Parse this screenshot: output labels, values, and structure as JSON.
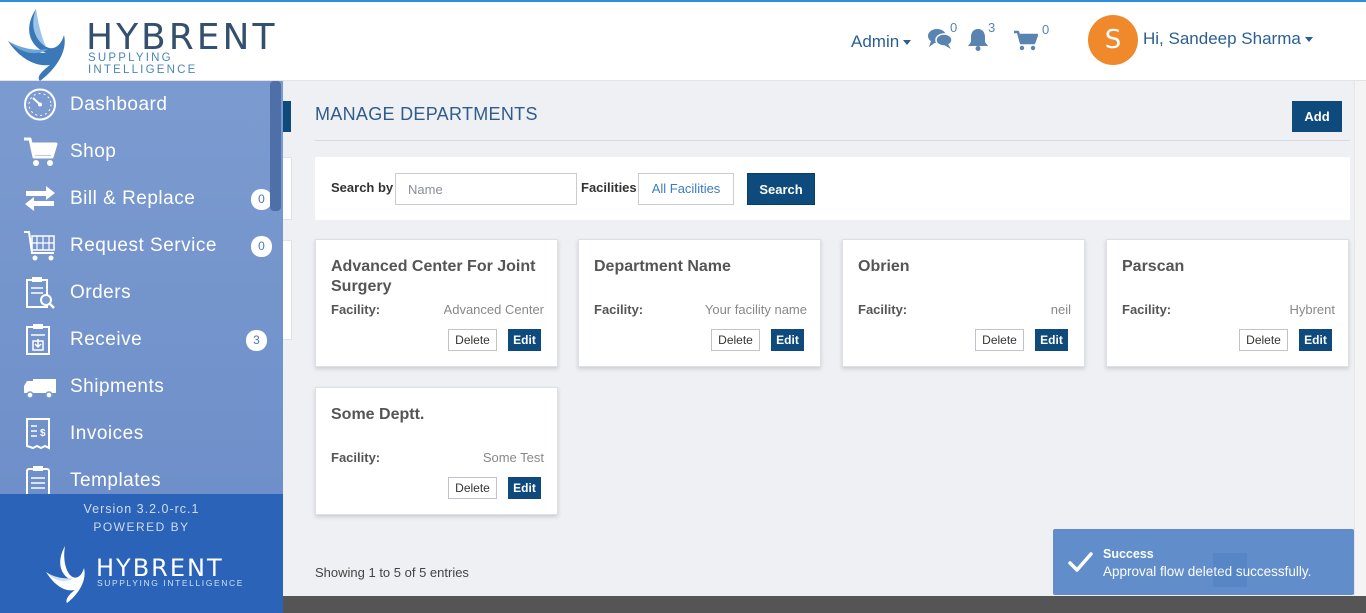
{
  "header": {
    "brand_name": "HYBRENT",
    "brand_tagline": "SUPPLYING INTELLIGENCE",
    "admin_label": "Admin",
    "messages_count": "0",
    "notifications_count": "3",
    "cart_count": "0",
    "avatar_initial": "S",
    "greeting": "Hi, Sandeep Sharma"
  },
  "sidebar": {
    "items": [
      {
        "label": "Dashboard",
        "icon": "dashboard-icon",
        "badge": ""
      },
      {
        "label": "Shop",
        "icon": "cart-icon",
        "badge": ""
      },
      {
        "label": "Bill & Replace",
        "icon": "exchange-icon",
        "badge": "0"
      },
      {
        "label": "Request Service",
        "icon": "service-cart-icon",
        "badge": "0"
      },
      {
        "label": "Orders",
        "icon": "orders-clipboard-icon",
        "badge": ""
      },
      {
        "label": "Receive",
        "icon": "receive-clipboard-icon",
        "badge": "3"
      },
      {
        "label": "Shipments",
        "icon": "truck-icon",
        "badge": ""
      },
      {
        "label": "Invoices",
        "icon": "invoice-icon",
        "badge": ""
      },
      {
        "label": "Templates",
        "icon": "templates-icon",
        "badge": ""
      }
    ],
    "version": "Version 3.2.0-rc.1",
    "powered_by": "POWERED BY",
    "footer_brand": "HYBRENT",
    "footer_tagline": "SUPPLYING INTELLIGENCE"
  },
  "main": {
    "title": "MANAGE DEPARTMENTS",
    "add_label": "Add",
    "search": {
      "label": "Search by",
      "placeholder": "Name",
      "value": "",
      "facilities_label": "Facilities",
      "facilities_selected": "All Facilities",
      "button_label": "Search"
    },
    "facility_label": "Facility:",
    "delete_label": "Delete",
    "edit_label": "Edit",
    "departments": [
      {
        "name": "Advanced Center For Joint Surgery",
        "facility": "Advanced Center"
      },
      {
        "name": "Department Name",
        "facility": "Your facility name"
      },
      {
        "name": "Obrien",
        "facility": "neil"
      },
      {
        "name": "Parscan",
        "facility": "Hybrent"
      },
      {
        "name": "Some Deptt.",
        "facility": "Some Test"
      }
    ],
    "entries_text": "Showing 1 to 5 of 5 entries"
  },
  "toast": {
    "title": "Success",
    "message": "Approval flow deleted successfully."
  },
  "colors": {
    "primary": "#0e4a7c",
    "sidebar": "#6e8fc9",
    "sidebar_footer": "#2a63b8",
    "avatar": "#f0892c",
    "toast": "#5a88c8"
  }
}
